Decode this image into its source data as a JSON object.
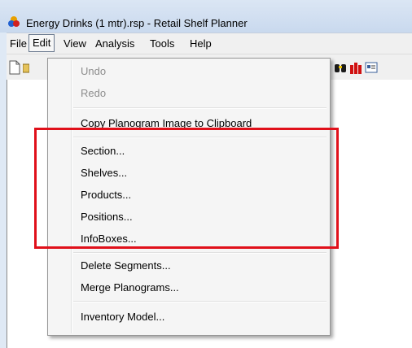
{
  "window": {
    "title": "Energy Drinks (1 mtr).rsp - Retail Shelf Planner",
    "app_icon": "retail-shelf-planner-icon"
  },
  "menubar": {
    "items": [
      "File",
      "Edit",
      "View",
      "Analysis",
      "Tools",
      "Help"
    ],
    "active": "Edit"
  },
  "toolbar": {
    "icons": [
      "new-document-icon",
      "open-folder-icon",
      "paint-bucket-icon",
      "binoculars-icon",
      "red-products-icon",
      "infobox-icon"
    ]
  },
  "edit_menu": {
    "undo": "Undo",
    "redo": "Redo",
    "copy_image": "Copy Planogram Image to Clipboard",
    "section": "Section...",
    "shelves": "Shelves...",
    "products": "Products...",
    "positions": "Positions...",
    "infoboxes": "InfoBoxes...",
    "delete_segments": "Delete Segments...",
    "merge_planograms": "Merge Planograms...",
    "inventory_model": "Inventory Model..."
  },
  "colors": {
    "highlight": "#e0101a",
    "menu_bg": "#f5f5f5",
    "disabled_text": "#8d8d8d"
  }
}
